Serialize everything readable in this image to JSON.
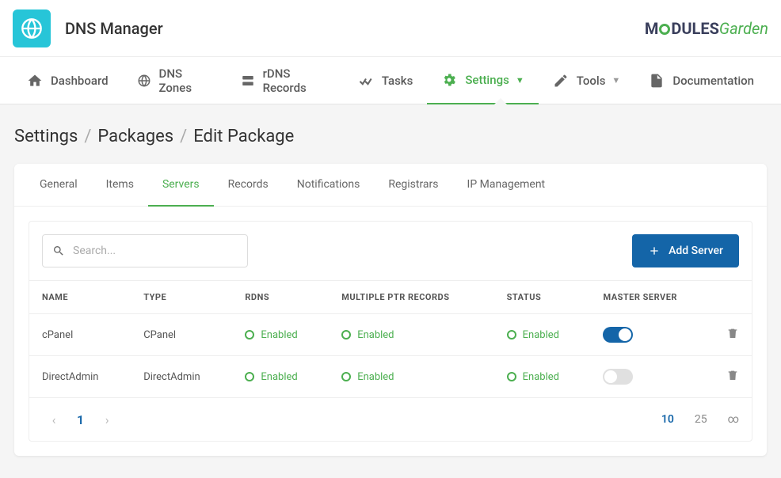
{
  "app": {
    "title": "DNS Manager"
  },
  "brand": {
    "pre": "M",
    "o": "O",
    "mid": "DULES",
    "suf": "Garden"
  },
  "nav": {
    "dashboard": "Dashboard",
    "zones": "DNS Zones",
    "rdns": "rDNS Records",
    "tasks": "Tasks",
    "settings": "Settings",
    "tools": "Tools",
    "docs": "Documentation"
  },
  "crumbs": {
    "a": "Settings",
    "b": "Packages",
    "c": "Edit Package"
  },
  "tabs": {
    "general": "General",
    "items": "Items",
    "servers": "Servers",
    "records": "Records",
    "notifications": "Notifications",
    "registrars": "Registrars",
    "ip": "IP Management"
  },
  "search": {
    "placeholder": "Search..."
  },
  "addBtn": "Add Server",
  "cols": {
    "name": "NAME",
    "type": "TYPE",
    "rdns": "RDNS",
    "ptr": "MULTIPLE PTR RECORDS",
    "status": "STATUS",
    "master": "MASTER SERVER"
  },
  "rows": [
    {
      "name": "cPanel",
      "type": "CPanel",
      "rdns": "Enabled",
      "ptr": "Enabled",
      "status": "Enabled",
      "master": true
    },
    {
      "name": "DirectAdmin",
      "type": "DirectAdmin",
      "rdns": "Enabled",
      "ptr": "Enabled",
      "status": "Enabled",
      "master": false
    }
  ],
  "pager": {
    "page": "1",
    "sizes": [
      "10",
      "25",
      "∞"
    ],
    "active": "10"
  }
}
